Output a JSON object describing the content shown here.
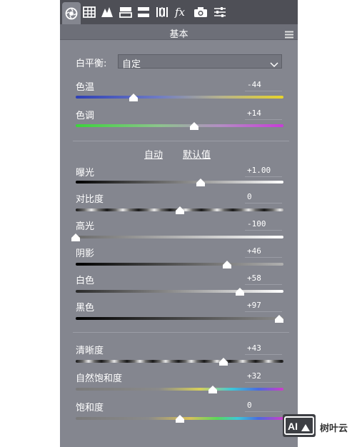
{
  "toolbar": {
    "icons": [
      "aperture-icon",
      "grid-icon",
      "mountains-icon",
      "split-bars-icon",
      "two-bars-icon",
      "lens-icon",
      "fx-icon",
      "camera-icon",
      "sliders-icon"
    ]
  },
  "panel": {
    "title": "基本",
    "white_balance": {
      "label": "白平衡:",
      "value": "自定"
    },
    "auto_label": "自动",
    "default_label": "默认值"
  },
  "sliders": {
    "temp": {
      "label": "色温",
      "value": "-44",
      "level": 0.28
    },
    "tint": {
      "label": "色调",
      "value": "+14",
      "level": 0.57
    },
    "exposure": {
      "label": "曝光",
      "value": "+1.00",
      "level": 0.6
    },
    "contrast": {
      "label": "对比度",
      "value": "0",
      "level": 0.5
    },
    "highlights": {
      "label": "高光",
      "value": "-100",
      "level": 0.0
    },
    "shadows": {
      "label": "阴影",
      "value": "+46",
      "level": 0.73
    },
    "whites": {
      "label": "白色",
      "value": "+58",
      "level": 0.79
    },
    "blacks": {
      "label": "黑色",
      "value": "+97",
      "level": 0.98
    },
    "clarity": {
      "label": "清晰度",
      "value": "+43",
      "level": 0.71
    },
    "vibrance": {
      "label": "自然饱和度",
      "value": "+32",
      "level": 0.66
    },
    "saturation": {
      "label": "饱和度",
      "value": "0",
      "level": 0.5
    }
  },
  "watermark": {
    "text": "树叶云",
    "logo_text": "AI"
  }
}
